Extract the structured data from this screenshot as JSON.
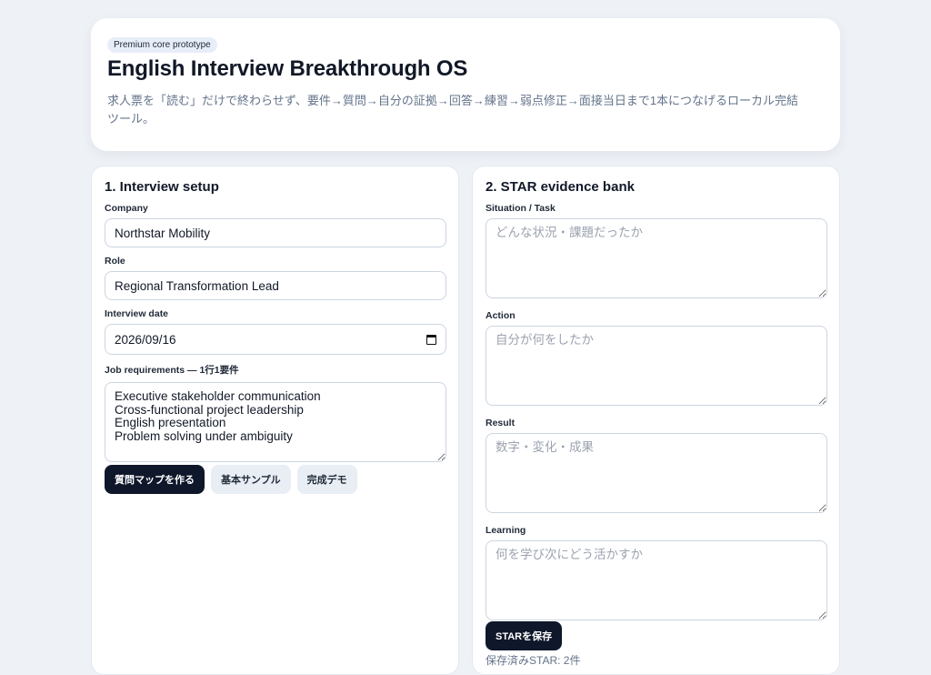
{
  "hero": {
    "badge": "Premium core prototype",
    "title": "English Interview Breakthrough OS",
    "description": "求人票を「読む」だけで終わらせず、要件→質問→自分の証拠→回答→練習→弱点修正→面接当日まで1本につなげるローカル完結ツール。"
  },
  "setup": {
    "heading": "1. Interview setup",
    "company_label": "Company",
    "company_value": "Northstar Mobility",
    "role_label": "Role",
    "role_value": "Regional Transformation Lead",
    "date_label": "Interview date",
    "date_value": "2026/09/16",
    "requirements_label": "Job requirements — 1行1要件",
    "requirements_value": "Executive stakeholder communication\nCross-functional project leadership\nEnglish presentation\nProblem solving under ambiguity",
    "buttons": {
      "build": "質問マップを作る",
      "sample": "基本サンプル",
      "demo": "完成デモ"
    }
  },
  "star": {
    "heading": "2. STAR evidence bank",
    "situation_label": "Situation / Task",
    "situation_placeholder": "どんな状況・課題だったか",
    "action_label": "Action",
    "action_placeholder": "自分が何をしたか",
    "result_label": "Result",
    "result_placeholder": "数字・変化・成果",
    "learning_label": "Learning",
    "learning_placeholder": "何を学び次にどう活かすか",
    "save_button": "STARを保存",
    "saved_count": "保存済みSTAR: 2件"
  },
  "colors": {
    "background": "#eef2f7",
    "primary_button": "#0f172a",
    "secondary_button": "#e9eef5",
    "muted_text": "#64748b"
  }
}
